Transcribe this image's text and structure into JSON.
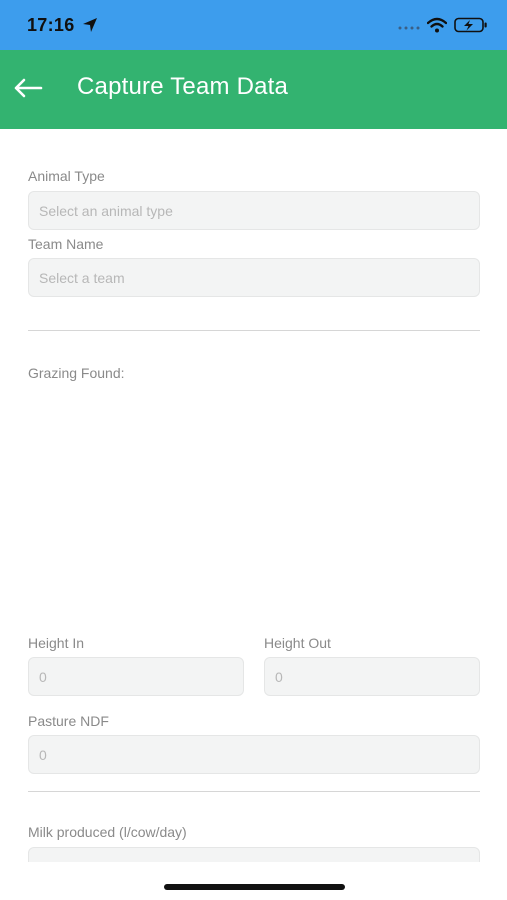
{
  "status_bar": {
    "time": "17:16",
    "icons": [
      "location-arrow-icon",
      "cellular-signal-icon",
      "wifi-icon",
      "battery-charging-icon"
    ]
  },
  "header": {
    "title": "Capture Team Data",
    "back_icon": "back-arrow-icon",
    "color": "#33b370"
  },
  "form": {
    "animal_type": {
      "label": "Animal Type",
      "placeholder": "Select an animal type"
    },
    "team_name": {
      "label": "Team Name",
      "placeholder": "Select a team"
    },
    "grazing_found_label": "Grazing Found:",
    "height_in": {
      "label": "Height In",
      "value": "0"
    },
    "height_out": {
      "label": "Height Out",
      "value": "0"
    },
    "pasture_ndf": {
      "label": "Pasture NDF",
      "value": "0"
    },
    "milk_produced": {
      "label": "Milk produced (l/cow/day)",
      "value": ""
    }
  },
  "colors": {
    "status_bar": "#3d9ded",
    "field_background": "#f3f4f4",
    "label_text": "#8a8a8a"
  }
}
